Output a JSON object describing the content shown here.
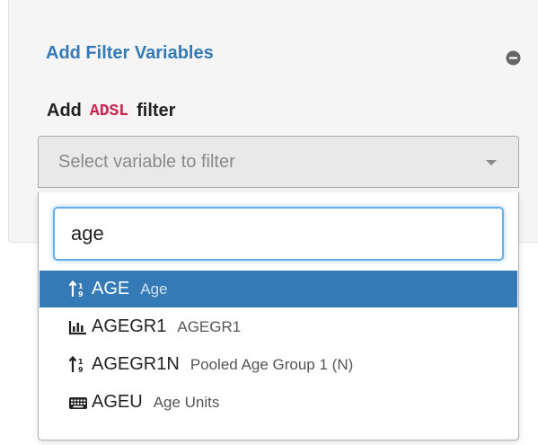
{
  "panel": {
    "title": "Add Filter Variables"
  },
  "filter": {
    "prefix": "Add",
    "dataset": "ADSL",
    "suffix": "filter"
  },
  "select": {
    "placeholder": "Select variable to filter"
  },
  "search": {
    "value": "age"
  },
  "options": [
    {
      "name": "AGE",
      "desc": "Age",
      "icon": "sort-numeric-icon",
      "active": true
    },
    {
      "name": "AGEGR1",
      "desc": "AGEGR1",
      "icon": "bar-chart-icon",
      "active": false
    },
    {
      "name": "AGEGR1N",
      "desc": "Pooled Age Group 1 (N)",
      "icon": "sort-numeric-icon",
      "active": false
    },
    {
      "name": "AGEU",
      "desc": "Age Units",
      "icon": "keyboard-icon",
      "active": false
    }
  ],
  "colors": {
    "accent": "#337ab7",
    "code": "#c7254e",
    "focus": "#66afe9"
  }
}
